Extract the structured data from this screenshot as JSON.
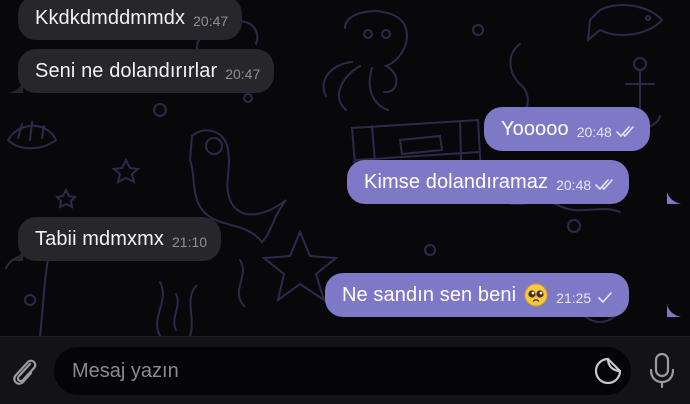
{
  "messages": [
    {
      "direction": "in",
      "text": "Kkdkdmddmmdx",
      "time": "20:47"
    },
    {
      "direction": "in",
      "text": "Seni ne dolandırırlar",
      "time": "20:47"
    },
    {
      "direction": "out",
      "text": "Yooooo",
      "time": "20:48",
      "status": "read",
      "status_icon": "double-check-icon"
    },
    {
      "direction": "out",
      "text": "Kimse dolandıramaz",
      "time": "20:48",
      "status": "read",
      "status_icon": "double-check-icon"
    },
    {
      "direction": "in",
      "text": "Tabii mdmxmx",
      "time": "21:10"
    },
    {
      "direction": "out",
      "text": "Ne sandın sen beni",
      "emoji": "pleading-face",
      "time": "21:25",
      "status": "sent",
      "status_icon": "single-check-icon"
    }
  ],
  "composer": {
    "placeholder": "Mesaj yazın",
    "value": "",
    "attach_icon": "paperclip-icon",
    "sticker_icon": "sticker-icon",
    "mic_icon": "microphone-icon"
  },
  "colors": {
    "background": "#08080b",
    "wallpaper_lines": "#2c2a4a",
    "incoming_bubble": "#27272b",
    "outgoing_bubble": "#7d79c6",
    "composer_bar": "#131316",
    "input_field": "#050507"
  }
}
